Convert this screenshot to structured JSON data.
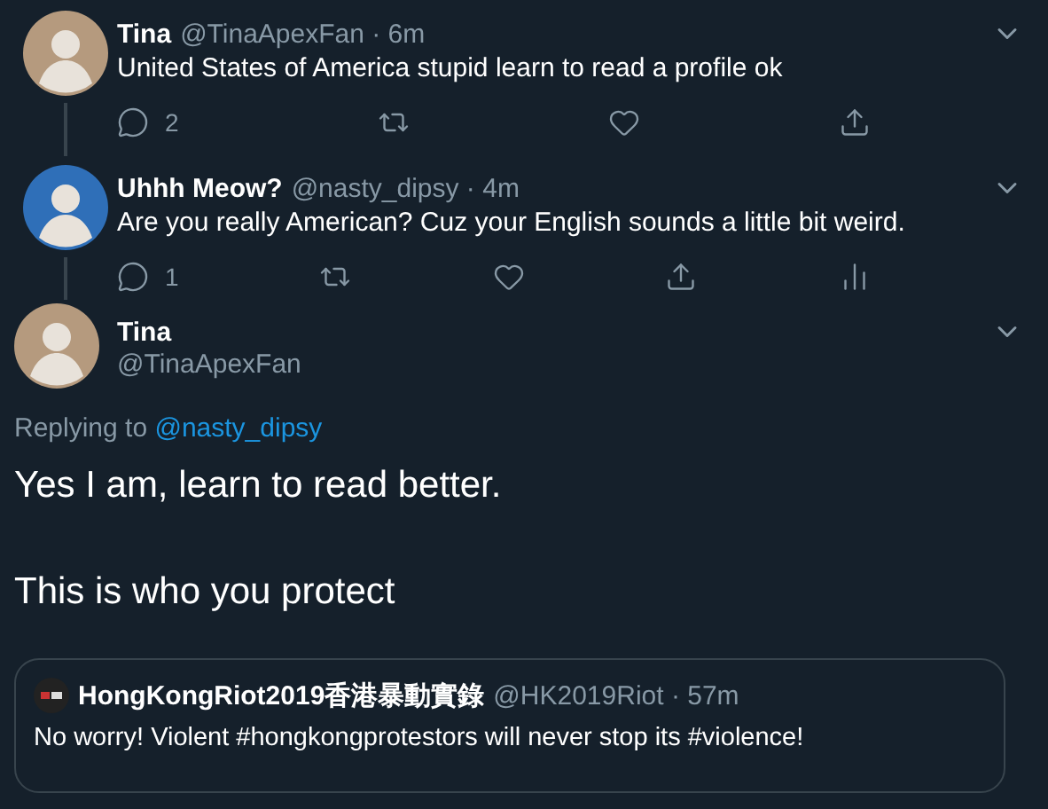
{
  "tweets": [
    {
      "name": "Tina",
      "meta": "@TinaApexFan · 6m",
      "color": "#b59a7e",
      "text": "United States of America stupid learn to read a profile ok",
      "actions": [
        {
          "kind": "reply",
          "count": "2"
        },
        {
          "kind": "retweet"
        },
        {
          "kind": "like"
        },
        {
          "kind": "share"
        }
      ]
    },
    {
      "name": "Uhhh Meow?",
      "meta": "@nasty_dipsy · 4m",
      "color": "#2f6fb8",
      "text": "Are you really American? Cuz your English sounds a little bit weird.",
      "actions": [
        {
          "kind": "reply",
          "count": "1"
        },
        {
          "kind": "retweet"
        },
        {
          "kind": "like"
        },
        {
          "kind": "share"
        },
        {
          "kind": "analytics"
        }
      ]
    }
  ],
  "focus": {
    "name": "Tina",
    "handle": "@TinaApexFan",
    "color": "#b59a7e",
    "replying_label": "Replying to",
    "replying_to": "@nasty_dipsy",
    "paragraphs": [
      "Yes I am, learn to read better.",
      "This is who you protect"
    ],
    "quote": {
      "name": "HongKongRiot2019香港暴動實錄",
      "meta": "@HK2019Riot · 57m",
      "text": "No worry! Violent #hongkongprotestors will never stop its #violence!"
    }
  }
}
